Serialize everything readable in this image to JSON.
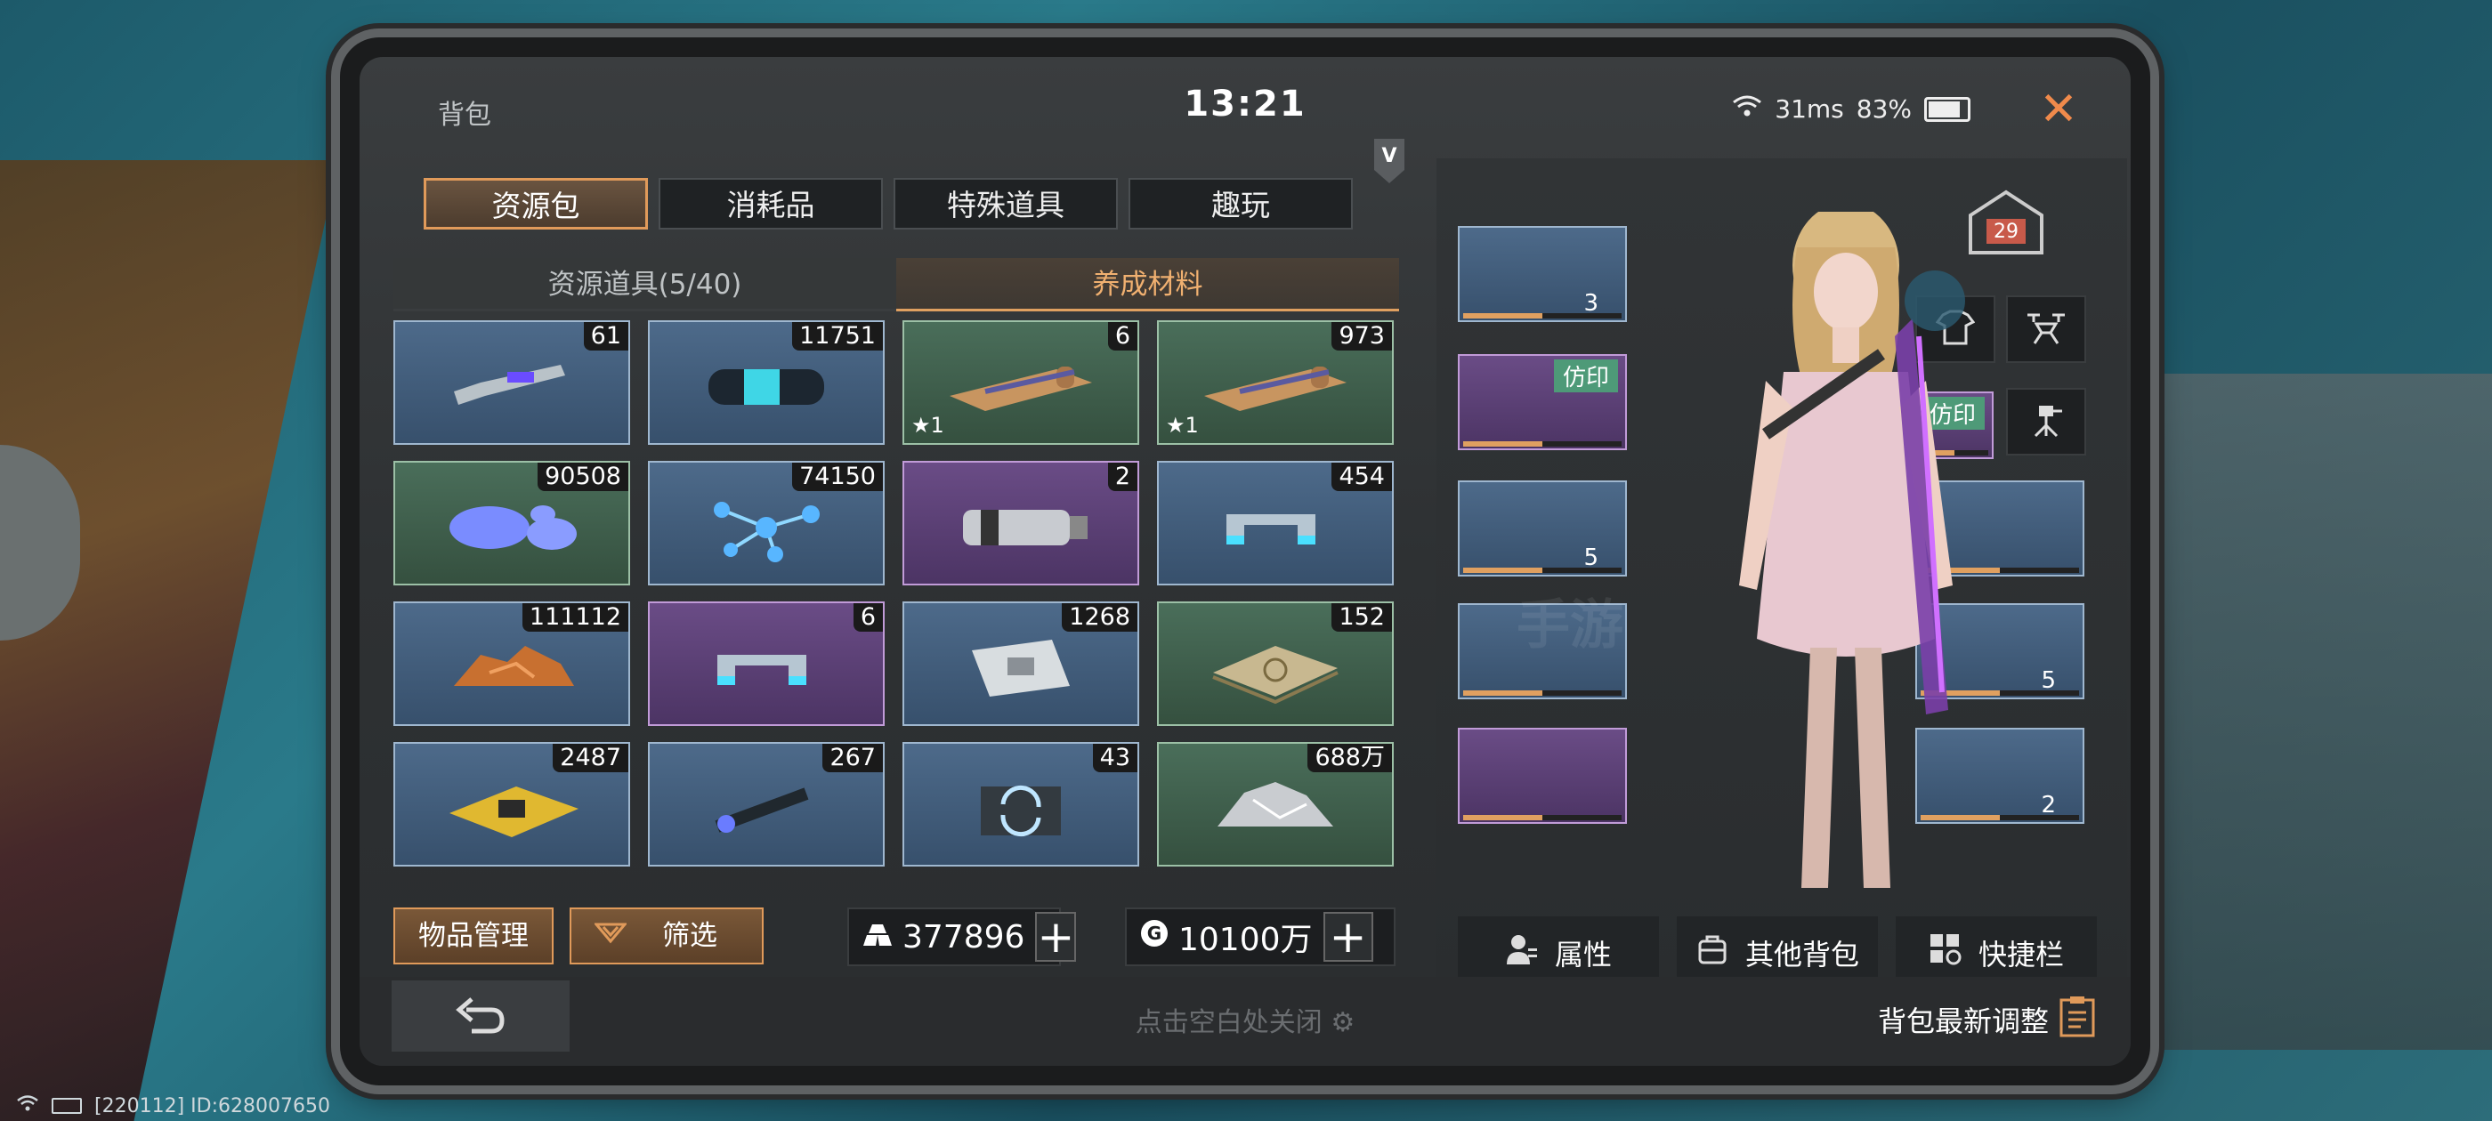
{
  "header": {
    "bag_title": "背包",
    "clock": "13:21",
    "ping": "31ms",
    "battery": "83%",
    "battery_level": 0.83
  },
  "tabs": [
    "资源包",
    "消耗品",
    "特殊道具",
    "趣玩"
  ],
  "subtabs": [
    "资源道具(5/40)",
    "养成材料"
  ],
  "items": [
    {
      "count": "61",
      "tone": "blue",
      "icon": "wrench-icon",
      "star": ""
    },
    {
      "count": "11751",
      "tone": "blue",
      "icon": "cylinder-icon",
      "star": ""
    },
    {
      "count": "6",
      "tone": "green",
      "icon": "cloth-roll-icon",
      "star": "1"
    },
    {
      "count": "973",
      "tone": "green",
      "icon": "cloth-roll-icon",
      "star": "1"
    },
    {
      "count": "90508",
      "tone": "green",
      "icon": "gel-drops-icon",
      "star": ""
    },
    {
      "count": "74150",
      "tone": "blue",
      "icon": "molecule-icon",
      "star": ""
    },
    {
      "count": "2",
      "tone": "purple",
      "icon": "canister-icon",
      "star": ""
    },
    {
      "count": "454",
      "tone": "blue",
      "icon": "clamp-icon",
      "star": ""
    },
    {
      "count": "111112",
      "tone": "blue",
      "icon": "ore-icon",
      "star": ""
    },
    {
      "count": "6",
      "tone": "purple",
      "icon": "clamp-icon",
      "star": ""
    },
    {
      "count": "1268",
      "tone": "blue",
      "icon": "packet-icon",
      "star": ""
    },
    {
      "count": "152",
      "tone": "green",
      "icon": "tablet-stack-icon",
      "star": ""
    },
    {
      "count": "2487",
      "tone": "blue",
      "icon": "chip-icon",
      "star": ""
    },
    {
      "count": "267",
      "tone": "blue",
      "icon": "laser-icon",
      "star": ""
    },
    {
      "count": "43",
      "tone": "blue",
      "icon": "refresh-card-icon",
      "star": ""
    },
    {
      "count": "688万",
      "tone": "green",
      "icon": "metal-ore-icon",
      "star": ""
    }
  ],
  "buttons": {
    "manage": "物品管理",
    "filter": "筛选"
  },
  "currency": {
    "gold": "377896",
    "coin": "10100万"
  },
  "footer": {
    "close_hint": "点击空白处关闭",
    "latest": "背包最新调整"
  },
  "equipment": {
    "left_slots": [
      {
        "tone": "blue",
        "num": "3",
        "tag": ""
      },
      {
        "tone": "purple",
        "num": "",
        "tag": "仿印"
      },
      {
        "tone": "blue",
        "num": "5",
        "tag": ""
      },
      {
        "tone": "blue",
        "num": "",
        "tag": ""
      },
      {
        "tone": "purple",
        "num": "",
        "tag": ""
      }
    ],
    "right_slots": [
      {
        "tone": "purple",
        "num": "",
        "tag": "仿印"
      },
      {
        "tone": "blue",
        "num": "",
        "tag": ""
      },
      {
        "tone": "blue",
        "num": "5",
        "tag": ""
      },
      {
        "tone": "blue",
        "num": "2",
        "tag": ""
      }
    ],
    "level": "29"
  },
  "actions": [
    "属性",
    "其他背包",
    "快捷栏"
  ],
  "statusbar": {
    "build": "[220112] ID:628007650"
  },
  "colors": {
    "accent": "#e09a5a",
    "close": "#f08a4b"
  }
}
